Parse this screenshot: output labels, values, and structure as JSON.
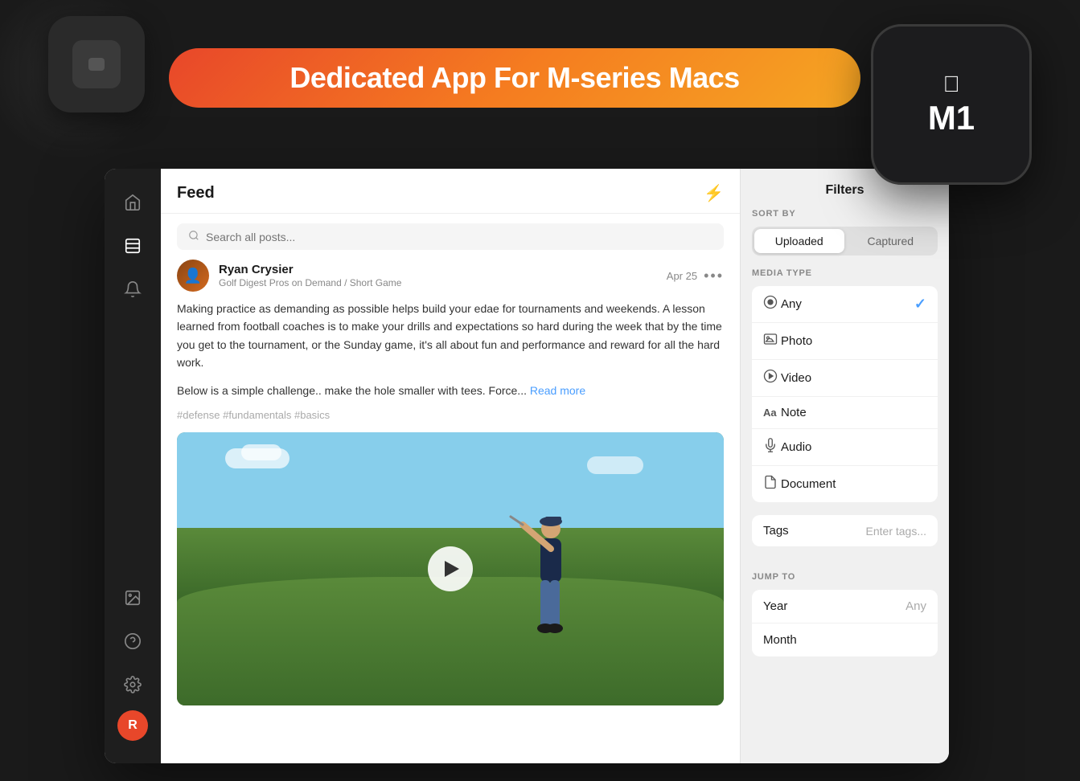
{
  "banner": {
    "text": "Dedicated App For M-series Macs"
  },
  "chip": {
    "label": "M1",
    "apple_symbol": ""
  },
  "sidebar": {
    "icons": [
      {
        "name": "home-icon",
        "symbol": "⌂",
        "active": false
      },
      {
        "name": "feed-icon",
        "symbol": "≡",
        "active": true
      },
      {
        "name": "notification-icon",
        "symbol": "🔔",
        "active": false
      },
      {
        "name": "gallery-icon",
        "symbol": "⊞",
        "active": false
      },
      {
        "name": "help-icon",
        "symbol": "◎",
        "active": false
      },
      {
        "name": "settings-icon",
        "symbol": "⚙",
        "active": false
      }
    ],
    "avatar_letter": "R"
  },
  "feed": {
    "title": "Feed",
    "search_placeholder": "Search all posts...",
    "post": {
      "author": "Ryan Crysier",
      "channel": "Golf Digest Pros on Demand / Short Game",
      "date": "Apr 25",
      "text_part1": "Making practice as demanding as possible helps build your edae for tournaments and weekends. A lesson learned from football coaches is to make your drills and expectations so hard during the week that by the time you get to the tournament, or the Sunday game, it's all about fun and performance and reward for all the hard work.",
      "text_part2": "Below is a simple challenge.. make the hole smaller with tees. Force...",
      "read_more": "Read more",
      "tags": "#defense #fundamentals #basics"
    }
  },
  "filters": {
    "title": "Filters",
    "sort_by_label": "SORT BY",
    "sort_options": [
      {
        "label": "Uploaded",
        "active": true
      },
      {
        "label": "Captured",
        "active": false
      }
    ],
    "media_type_label": "MEDIA TYPE",
    "media_types": [
      {
        "name": "any-option",
        "icon": "◎",
        "label": "Any",
        "checked": true
      },
      {
        "name": "photo-option",
        "icon": "📷",
        "label": "Photo",
        "checked": false
      },
      {
        "name": "video-option",
        "icon": "▶",
        "label": "Video",
        "checked": false
      },
      {
        "name": "note-option",
        "icon": "Aa",
        "label": "Note",
        "checked": false
      },
      {
        "name": "audio-option",
        "icon": "🎙",
        "label": "Audio",
        "checked": false
      },
      {
        "name": "document-option",
        "icon": "📄",
        "label": "Document",
        "checked": false
      }
    ],
    "tags_label": "Tags",
    "tags_placeholder": "Enter tags...",
    "jump_to_label": "JUMP TO",
    "jump_to_items": [
      {
        "label": "Year",
        "value": "Any"
      },
      {
        "label": "Month",
        "value": ""
      }
    ]
  }
}
